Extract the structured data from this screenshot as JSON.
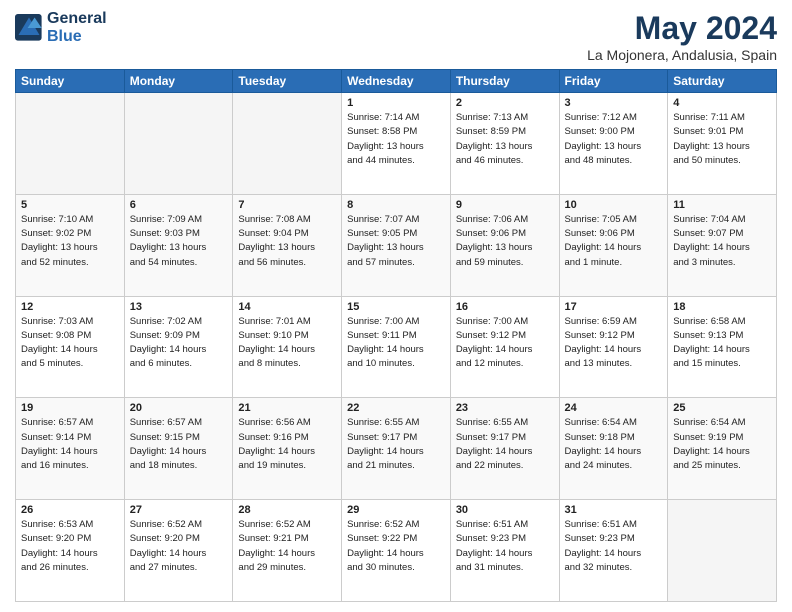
{
  "header": {
    "logo_line1": "General",
    "logo_line2": "Blue",
    "title": "May 2024",
    "subtitle": "La Mojonera, Andalusia, Spain"
  },
  "days_of_week": [
    "Sunday",
    "Monday",
    "Tuesday",
    "Wednesday",
    "Thursday",
    "Friday",
    "Saturday"
  ],
  "weeks": [
    [
      {
        "day": "",
        "details": []
      },
      {
        "day": "",
        "details": []
      },
      {
        "day": "",
        "details": []
      },
      {
        "day": "1",
        "details": [
          "Sunrise: 7:14 AM",
          "Sunset: 8:58 PM",
          "Daylight: 13 hours",
          "and 44 minutes."
        ]
      },
      {
        "day": "2",
        "details": [
          "Sunrise: 7:13 AM",
          "Sunset: 8:59 PM",
          "Daylight: 13 hours",
          "and 46 minutes."
        ]
      },
      {
        "day": "3",
        "details": [
          "Sunrise: 7:12 AM",
          "Sunset: 9:00 PM",
          "Daylight: 13 hours",
          "and 48 minutes."
        ]
      },
      {
        "day": "4",
        "details": [
          "Sunrise: 7:11 AM",
          "Sunset: 9:01 PM",
          "Daylight: 13 hours",
          "and 50 minutes."
        ]
      }
    ],
    [
      {
        "day": "5",
        "details": [
          "Sunrise: 7:10 AM",
          "Sunset: 9:02 PM",
          "Daylight: 13 hours",
          "and 52 minutes."
        ]
      },
      {
        "day": "6",
        "details": [
          "Sunrise: 7:09 AM",
          "Sunset: 9:03 PM",
          "Daylight: 13 hours",
          "and 54 minutes."
        ]
      },
      {
        "day": "7",
        "details": [
          "Sunrise: 7:08 AM",
          "Sunset: 9:04 PM",
          "Daylight: 13 hours",
          "and 56 minutes."
        ]
      },
      {
        "day": "8",
        "details": [
          "Sunrise: 7:07 AM",
          "Sunset: 9:05 PM",
          "Daylight: 13 hours",
          "and 57 minutes."
        ]
      },
      {
        "day": "9",
        "details": [
          "Sunrise: 7:06 AM",
          "Sunset: 9:06 PM",
          "Daylight: 13 hours",
          "and 59 minutes."
        ]
      },
      {
        "day": "10",
        "details": [
          "Sunrise: 7:05 AM",
          "Sunset: 9:06 PM",
          "Daylight: 14 hours",
          "and 1 minute."
        ]
      },
      {
        "day": "11",
        "details": [
          "Sunrise: 7:04 AM",
          "Sunset: 9:07 PM",
          "Daylight: 14 hours",
          "and 3 minutes."
        ]
      }
    ],
    [
      {
        "day": "12",
        "details": [
          "Sunrise: 7:03 AM",
          "Sunset: 9:08 PM",
          "Daylight: 14 hours",
          "and 5 minutes."
        ]
      },
      {
        "day": "13",
        "details": [
          "Sunrise: 7:02 AM",
          "Sunset: 9:09 PM",
          "Daylight: 14 hours",
          "and 6 minutes."
        ]
      },
      {
        "day": "14",
        "details": [
          "Sunrise: 7:01 AM",
          "Sunset: 9:10 PM",
          "Daylight: 14 hours",
          "and 8 minutes."
        ]
      },
      {
        "day": "15",
        "details": [
          "Sunrise: 7:00 AM",
          "Sunset: 9:11 PM",
          "Daylight: 14 hours",
          "and 10 minutes."
        ]
      },
      {
        "day": "16",
        "details": [
          "Sunrise: 7:00 AM",
          "Sunset: 9:12 PM",
          "Daylight: 14 hours",
          "and 12 minutes."
        ]
      },
      {
        "day": "17",
        "details": [
          "Sunrise: 6:59 AM",
          "Sunset: 9:12 PM",
          "Daylight: 14 hours",
          "and 13 minutes."
        ]
      },
      {
        "day": "18",
        "details": [
          "Sunrise: 6:58 AM",
          "Sunset: 9:13 PM",
          "Daylight: 14 hours",
          "and 15 minutes."
        ]
      }
    ],
    [
      {
        "day": "19",
        "details": [
          "Sunrise: 6:57 AM",
          "Sunset: 9:14 PM",
          "Daylight: 14 hours",
          "and 16 minutes."
        ]
      },
      {
        "day": "20",
        "details": [
          "Sunrise: 6:57 AM",
          "Sunset: 9:15 PM",
          "Daylight: 14 hours",
          "and 18 minutes."
        ]
      },
      {
        "day": "21",
        "details": [
          "Sunrise: 6:56 AM",
          "Sunset: 9:16 PM",
          "Daylight: 14 hours",
          "and 19 minutes."
        ]
      },
      {
        "day": "22",
        "details": [
          "Sunrise: 6:55 AM",
          "Sunset: 9:17 PM",
          "Daylight: 14 hours",
          "and 21 minutes."
        ]
      },
      {
        "day": "23",
        "details": [
          "Sunrise: 6:55 AM",
          "Sunset: 9:17 PM",
          "Daylight: 14 hours",
          "and 22 minutes."
        ]
      },
      {
        "day": "24",
        "details": [
          "Sunrise: 6:54 AM",
          "Sunset: 9:18 PM",
          "Daylight: 14 hours",
          "and 24 minutes."
        ]
      },
      {
        "day": "25",
        "details": [
          "Sunrise: 6:54 AM",
          "Sunset: 9:19 PM",
          "Daylight: 14 hours",
          "and 25 minutes."
        ]
      }
    ],
    [
      {
        "day": "26",
        "details": [
          "Sunrise: 6:53 AM",
          "Sunset: 9:20 PM",
          "Daylight: 14 hours",
          "and 26 minutes."
        ]
      },
      {
        "day": "27",
        "details": [
          "Sunrise: 6:52 AM",
          "Sunset: 9:20 PM",
          "Daylight: 14 hours",
          "and 27 minutes."
        ]
      },
      {
        "day": "28",
        "details": [
          "Sunrise: 6:52 AM",
          "Sunset: 9:21 PM",
          "Daylight: 14 hours",
          "and 29 minutes."
        ]
      },
      {
        "day": "29",
        "details": [
          "Sunrise: 6:52 AM",
          "Sunset: 9:22 PM",
          "Daylight: 14 hours",
          "and 30 minutes."
        ]
      },
      {
        "day": "30",
        "details": [
          "Sunrise: 6:51 AM",
          "Sunset: 9:23 PM",
          "Daylight: 14 hours",
          "and 31 minutes."
        ]
      },
      {
        "day": "31",
        "details": [
          "Sunrise: 6:51 AM",
          "Sunset: 9:23 PM",
          "Daylight: 14 hours",
          "and 32 minutes."
        ]
      },
      {
        "day": "",
        "details": []
      }
    ]
  ]
}
